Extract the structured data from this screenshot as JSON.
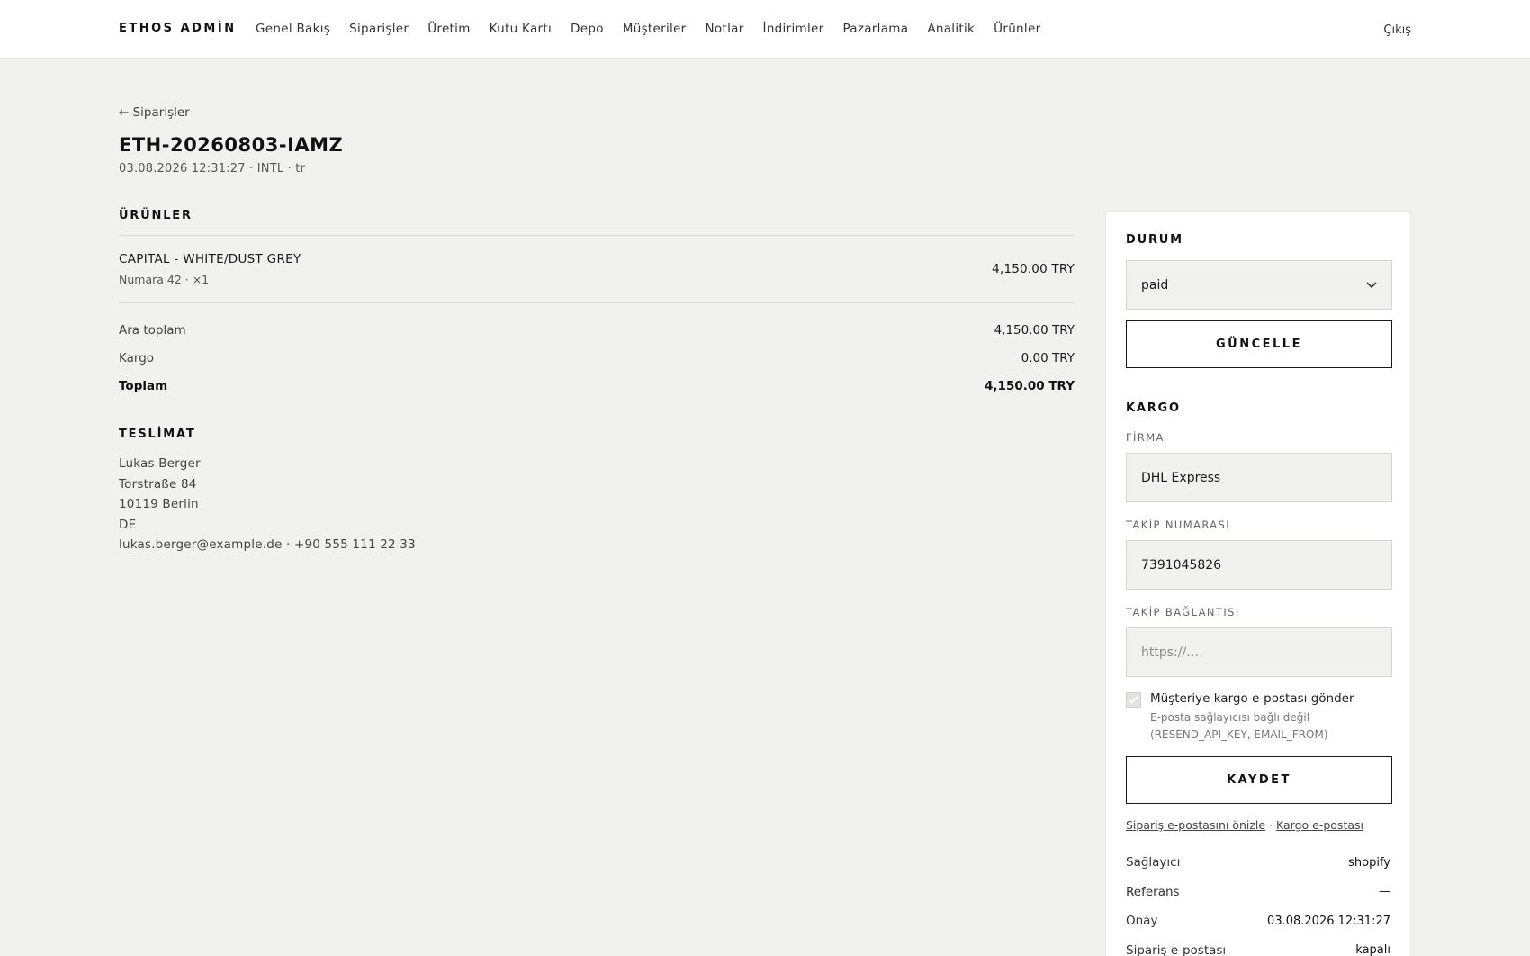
{
  "header": {
    "brand": "ETHOS ADMİN",
    "nav": [
      "Genel Bakış",
      "Siparişler",
      "Üretim",
      "Kutu Kartı",
      "Depo",
      "Müşteriler",
      "Notlar",
      "İndirimler",
      "Pazarlama",
      "Analitik",
      "Ürünler"
    ],
    "logout": "Çıkış"
  },
  "breadcrumb": {
    "arrow": "←",
    "label": "Siparişler"
  },
  "order": {
    "id": "ETH-20260803-IAMZ",
    "meta": "03.08.2026 12:31:27 · INTL · tr"
  },
  "products": {
    "title": "ÜRÜNLER",
    "items": [
      {
        "name": "CAPITAL - WHITE/DUST GREY",
        "sub": "Numara 42 · ×1",
        "price": "4,150.00 TRY"
      }
    ]
  },
  "summary": {
    "subtotal_label": "Ara toplam",
    "subtotal": "4,150.00 TRY",
    "shipping_label": "Kargo",
    "shipping": "0.00 TRY",
    "total_label": "Toplam",
    "total": "4,150.00 TRY"
  },
  "delivery": {
    "title": "TESLİMAT",
    "lines": [
      "Lukas Berger",
      "Torstraße 84",
      "10119 Berlin",
      "DE",
      "lukas.berger@example.de · +90 555 111 22 33"
    ]
  },
  "panel": {
    "status_title": "DURUM",
    "status_value": "paid",
    "update_button": "GÜNCELLE",
    "shipping_title": "KARGO",
    "carrier_label": "FİRMA",
    "carrier_value": "DHL Express",
    "tracking_label": "TAKİP NUMARASI",
    "tracking_value": "7391045826",
    "tracking_link_label": "TAKİP BAĞLANTISI",
    "tracking_link_placeholder": "https://…",
    "email_checkbox_label": "Müşteriye kargo e-postası gönder",
    "email_note": "E-posta sağlayıcısı bağlı değil (RESEND_API_KEY, EMAIL_FROM)",
    "save_button": "KAYDET",
    "preview_link": "Sipariş e-postasını önizle",
    "link_separator": "·",
    "shipping_email_link": "Kargo e-postası",
    "info": [
      {
        "key": "Sağlayıcı",
        "value": "shopify"
      },
      {
        "key": "Referans",
        "value": "—"
      },
      {
        "key": "Onay",
        "value": "03.08.2026 12:31:27"
      },
      {
        "key": "Sipariş e-postası",
        "value": "kapalı"
      }
    ]
  },
  "icons": {
    "back": "arrow-left-icon",
    "dropdown": "chevron-down-icon",
    "checkbox": "check-icon"
  }
}
